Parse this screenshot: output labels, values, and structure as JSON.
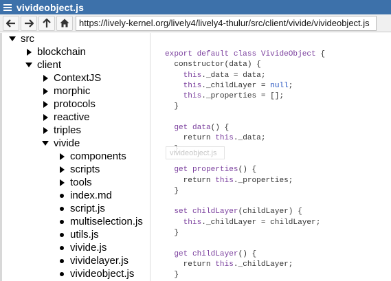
{
  "window": {
    "title": "vivideobject.js"
  },
  "toolbar": {
    "url": "https://lively-kernel.org/lively4/lively4-thulur/src/client/vivide/vivideobject.js"
  },
  "tree": {
    "rows": [
      {
        "label": "src",
        "kind": "folder-open",
        "level": 0
      },
      {
        "label": "blockchain",
        "kind": "folder-closed",
        "level": 1
      },
      {
        "label": "client",
        "kind": "folder-open",
        "level": 1
      },
      {
        "label": "ContextJS",
        "kind": "folder-closed",
        "level": 2
      },
      {
        "label": "morphic",
        "kind": "folder-closed",
        "level": 2
      },
      {
        "label": "protocols",
        "kind": "folder-closed",
        "level": 2
      },
      {
        "label": "reactive",
        "kind": "folder-closed",
        "level": 2
      },
      {
        "label": "triples",
        "kind": "folder-closed",
        "level": 2
      },
      {
        "label": "vivide",
        "kind": "folder-open",
        "level": 2
      },
      {
        "label": "components",
        "kind": "folder-closed",
        "level": 3
      },
      {
        "label": "scripts",
        "kind": "folder-closed",
        "level": 3
      },
      {
        "label": "tools",
        "kind": "folder-closed",
        "level": 3
      },
      {
        "label": "index.md",
        "kind": "file",
        "level": 3
      },
      {
        "label": "script.js",
        "kind": "file",
        "level": 3
      },
      {
        "label": "multiselection.js",
        "kind": "file",
        "level": 3
      },
      {
        "label": "utils.js",
        "kind": "file",
        "level": 3
      },
      {
        "label": "vivide.js",
        "kind": "file",
        "level": 3
      },
      {
        "label": "vividelayer.js",
        "kind": "file",
        "level": 3
      },
      {
        "label": "vivideobject.js",
        "kind": "file",
        "level": 3
      }
    ]
  },
  "tooltip": {
    "text": "vivideobject.js"
  },
  "code": {
    "lines": [
      [
        {
          "t": "export default class ",
          "c": "kw"
        },
        {
          "t": "VivideObject",
          "c": "name-def"
        },
        {
          "t": " {",
          "c": "def"
        }
      ],
      [
        {
          "t": "  constructor(data) {",
          "c": "def"
        }
      ],
      [
        {
          "t": "    ",
          "c": "def"
        },
        {
          "t": "this",
          "c": "kw"
        },
        {
          "t": "._data = data;",
          "c": "def"
        }
      ],
      [
        {
          "t": "    ",
          "c": "def"
        },
        {
          "t": "this",
          "c": "kw"
        },
        {
          "t": "._childLayer = ",
          "c": "def"
        },
        {
          "t": "null",
          "c": "atom"
        },
        {
          "t": ";",
          "c": "def"
        }
      ],
      [
        {
          "t": "    ",
          "c": "def"
        },
        {
          "t": "this",
          "c": "kw"
        },
        {
          "t": "._properties = [];",
          "c": "def"
        }
      ],
      [
        {
          "t": "  }",
          "c": "def"
        }
      ],
      [
        {
          "t": "",
          "c": "def"
        }
      ],
      [
        {
          "t": "  ",
          "c": "def"
        },
        {
          "t": "get",
          "c": "getset"
        },
        {
          "t": " ",
          "c": "def"
        },
        {
          "t": "data",
          "c": "name-def"
        },
        {
          "t": "() {",
          "c": "def"
        }
      ],
      [
        {
          "t": "    return ",
          "c": "def"
        },
        {
          "t": "this",
          "c": "kw"
        },
        {
          "t": "._data;",
          "c": "def"
        }
      ],
      [
        {
          "t": "  }",
          "c": "def"
        }
      ],
      [
        {
          "t": "",
          "c": "def"
        }
      ],
      [
        {
          "t": "  ",
          "c": "def"
        },
        {
          "t": "get",
          "c": "getset"
        },
        {
          "t": " ",
          "c": "def"
        },
        {
          "t": "properties",
          "c": "name-def"
        },
        {
          "t": "() {",
          "c": "def"
        }
      ],
      [
        {
          "t": "    return ",
          "c": "def"
        },
        {
          "t": "this",
          "c": "kw"
        },
        {
          "t": "._properties;",
          "c": "def"
        }
      ],
      [
        {
          "t": "  }",
          "c": "def"
        }
      ],
      [
        {
          "t": "",
          "c": "def"
        }
      ],
      [
        {
          "t": "  ",
          "c": "def"
        },
        {
          "t": "set",
          "c": "getset"
        },
        {
          "t": " ",
          "c": "def"
        },
        {
          "t": "childLayer",
          "c": "name-def"
        },
        {
          "t": "(childLayer) {",
          "c": "def"
        }
      ],
      [
        {
          "t": "    ",
          "c": "def"
        },
        {
          "t": "this",
          "c": "kw"
        },
        {
          "t": "._childLayer = childLayer;",
          "c": "def"
        }
      ],
      [
        {
          "t": "  }",
          "c": "def"
        }
      ],
      [
        {
          "t": "",
          "c": "def"
        }
      ],
      [
        {
          "t": "  ",
          "c": "def"
        },
        {
          "t": "get",
          "c": "getset"
        },
        {
          "t": " ",
          "c": "def"
        },
        {
          "t": "childLayer",
          "c": "name-def"
        },
        {
          "t": "() {",
          "c": "def"
        }
      ],
      [
        {
          "t": "    return ",
          "c": "def"
        },
        {
          "t": "this",
          "c": "kw"
        },
        {
          "t": "._childLayer;",
          "c": "def"
        }
      ],
      [
        {
          "t": "  }",
          "c": "def"
        }
      ]
    ]
  },
  "colors": {
    "titlebar": "#3d71aa",
    "keyword": "#7a3e9d",
    "atom": "#1f4fbf"
  },
  "icons": {
    "menu": "hamburger-icon",
    "back": "arrow-left-icon",
    "forward": "arrow-right-icon",
    "up": "arrow-up-icon",
    "home": "home-icon",
    "collapse": "triangle-down-icon",
    "expand": "triangle-right-icon",
    "file": "bullet-icon"
  }
}
